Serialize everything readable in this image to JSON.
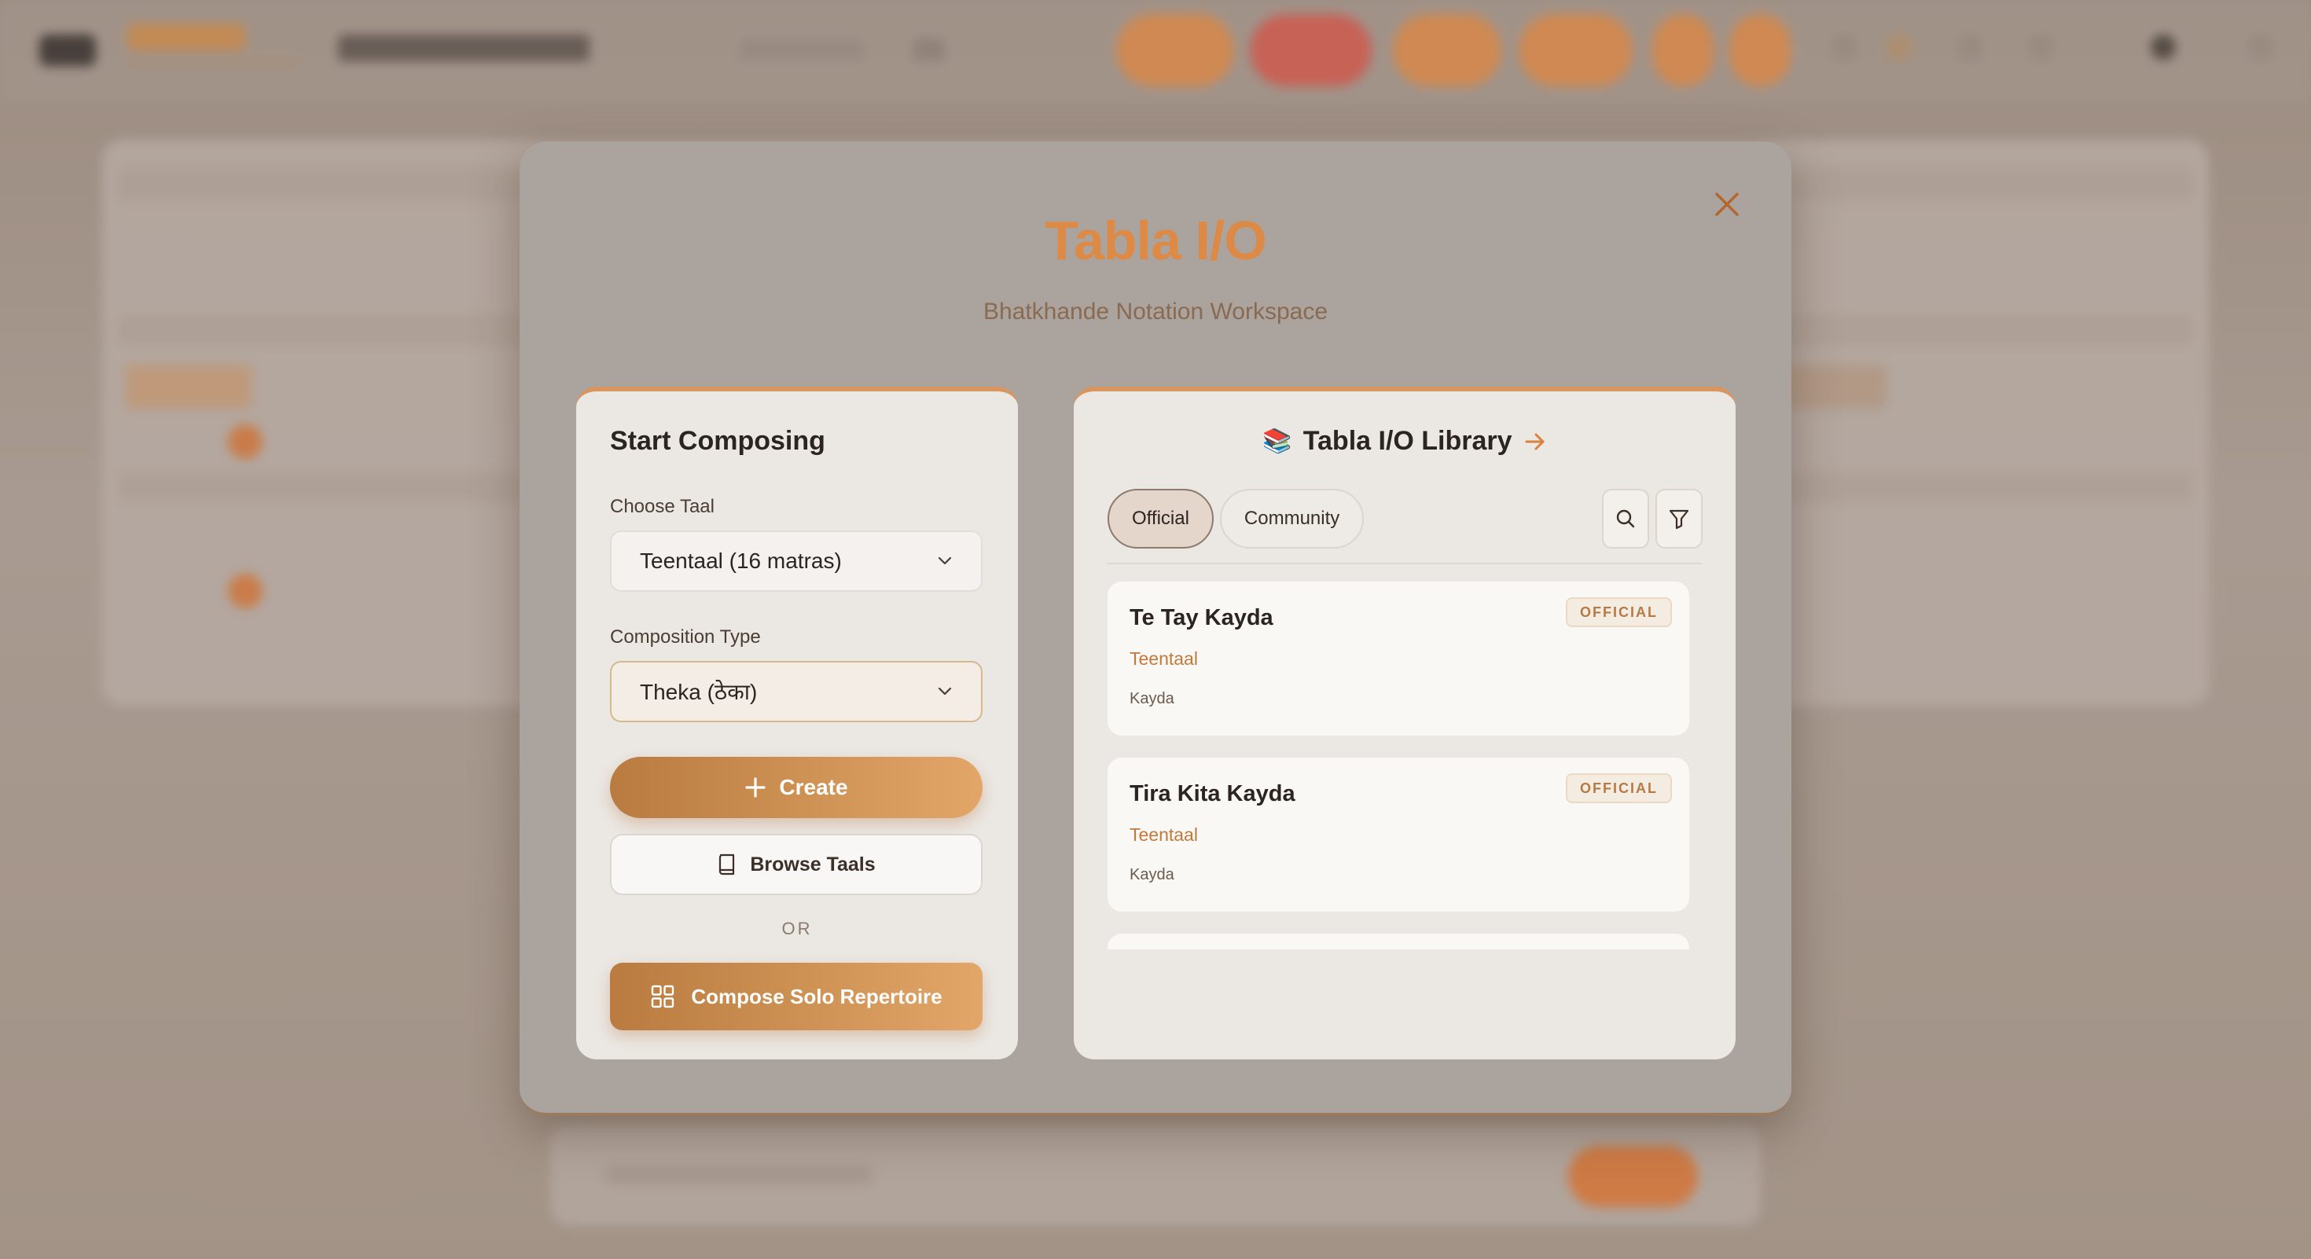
{
  "modal": {
    "title": "Tabla I/O",
    "subtitle": "Bhatkhande Notation Workspace"
  },
  "composer": {
    "heading": "Start Composing",
    "taal_label": "Choose Taal",
    "taal_value": "Teentaal (16 matras)",
    "type_label": "Composition Type",
    "type_value": "Theka (ठेका)",
    "create_label": "Create",
    "browse_label": "Browse Taals",
    "or_label": "OR",
    "solo_label": "Compose Solo Repertoire"
  },
  "library": {
    "emoji": "📚",
    "title": "Tabla I/O Library",
    "tabs": [
      {
        "label": "Official",
        "active": true
      },
      {
        "label": "Community",
        "active": false
      }
    ],
    "items": [
      {
        "title": "Te Tay Kayda",
        "taal": "Teentaal",
        "type": "Kayda",
        "badge": "OFFICIAL"
      },
      {
        "title": "Tira Kita Kayda",
        "taal": "Teentaal",
        "type": "Kayda",
        "badge": "OFFICIAL"
      }
    ]
  },
  "colors": {
    "accent": "#dd8a46",
    "button_gradient_start": "#b97b3f",
    "button_gradient_end": "#e2a668",
    "panel_bg": "#ebe7e3"
  },
  "icons": {
    "close": "close-icon",
    "chevron": "chevron-down-icon",
    "plus": "plus-icon",
    "book": "book-icon",
    "grid": "grid-icon",
    "arrow": "arrow-right-icon",
    "search": "search-icon",
    "filter": "filter-icon"
  }
}
